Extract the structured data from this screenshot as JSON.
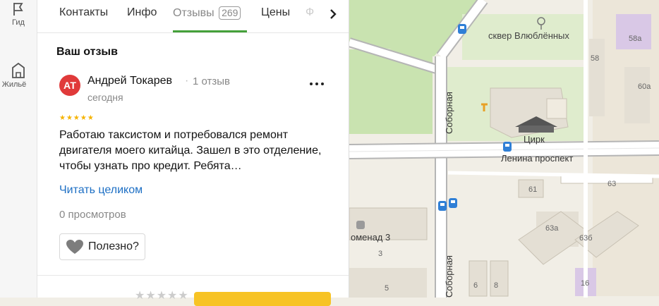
{
  "rail": {
    "items": [
      {
        "label": "Гид",
        "icon": "flag-icon"
      },
      {
        "label": "Жильё",
        "icon": "building-icon"
      }
    ]
  },
  "tabs": [
    {
      "label": "Контакты"
    },
    {
      "label": "Инфо"
    },
    {
      "label": "Отзывы",
      "count": "269",
      "active": true
    },
    {
      "label": "Цены"
    },
    {
      "label": "Ф"
    }
  ],
  "review_section": {
    "title": "Ваш отзыв"
  },
  "review": {
    "avatar_initials": "АТ",
    "avatar_color": "#e03a3a",
    "author": "Андрей Токарев",
    "separator": "·",
    "author_reviews": "1 отзыв",
    "date": "сегодня",
    "rating": "★★★★★",
    "text": "Работаю таксистом и потребовался ремонт двигателя моего китайца. Зашел в это отделение, чтобы узнать про кредит. Ребята…",
    "read_more": "Читать целиком",
    "views": "0 просмотров",
    "helpful_label": "Полезно?"
  },
  "bottom": {
    "stars": "★★★★★"
  },
  "map": {
    "labels": {
      "park": "сквер Влюблённых",
      "circus": "Цирк",
      "street_main": "Ленина проспект",
      "street_vertical_top": "Соборная",
      "street_vertical_bottom": "Соборная",
      "promenade": "оменад 3",
      "house_58": "58",
      "house_58a": "58а",
      "house_60a": "60а",
      "house_61": "61",
      "house_63": "63",
      "house_63a": "63а",
      "house_63b": "63б",
      "house_3": "3",
      "house_6": "6",
      "house_8": "8",
      "house_16": "16",
      "house_5": "5"
    },
    "colors": {
      "background": "#f1eee6",
      "park": "#c9e3b0",
      "road": "#ffffff",
      "road_casing": "#b5b5b5",
      "building": "#e4dfd4",
      "building_accent": "#d9c8e6",
      "transit": "#2f7fd6"
    }
  }
}
